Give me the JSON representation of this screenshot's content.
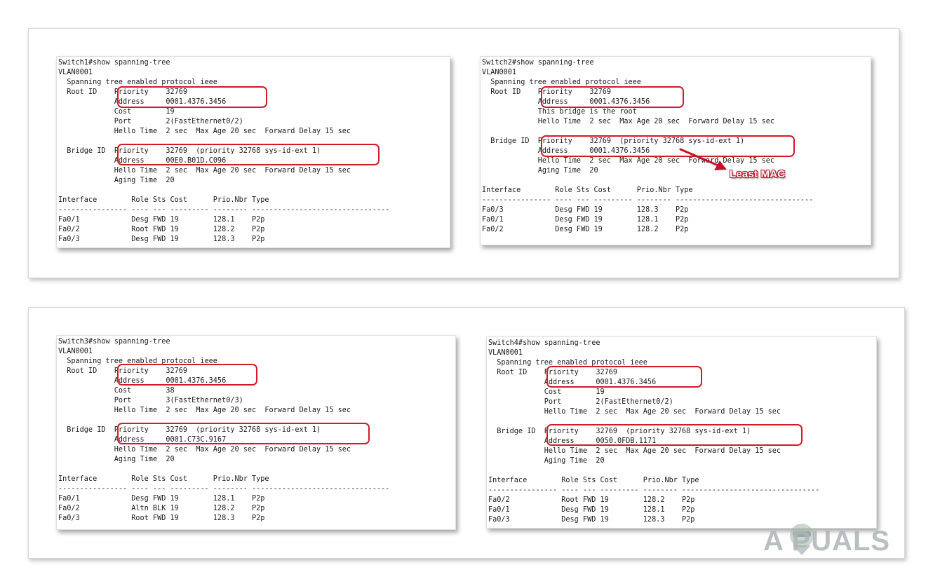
{
  "panels": [
    {
      "lines": [
        "Switch1#show spanning-tree",
        "VLAN0001",
        "  Spanning tree enabled protocol ieee",
        "  Root ID    Priority    32769",
        "             Address     0001.4376.3456",
        "             Cost        19",
        "             Port        2(FastEthernet0/2)",
        "             Hello Time  2 sec  Max Age 20 sec  Forward Delay 15 sec",
        "",
        "  Bridge ID  Priority    32769  (priority 32768 sys-id-ext 1)",
        "             Address     00E0.B01D.C096",
        "             Hello Time  2 sec  Max Age 20 sec  Forward Delay 15 sec",
        "             Aging Time  20",
        "",
        "Interface        Role Sts Cost      Prio.Nbr Type",
        "---------------- ---- --- --------- -------- --------------------------------",
        "Fa0/1            Desg FWD 19        128.1    P2p",
        "Fa0/2            Root FWD 19        128.2    P2p",
        "Fa0/3            Desg FWD 19        128.3    P2p"
      ]
    },
    {
      "lines": [
        "Switch2#show spanning-tree",
        "VLAN0001",
        "  Spanning tree enabled protocol ieee",
        "  Root ID    Priority    32769",
        "             Address     0001.4376.3456",
        "             This bridge is the root",
        "             Hello Time  2 sec  Max Age 20 sec  Forward Delay 15 sec",
        "",
        "  Bridge ID  Priority    32769  (priority 32768 sys-id-ext 1)",
        "             Address     0001.4376.3456",
        "             Hello Time  2 sec  Max Age 20 sec  Forward Delay 15 sec",
        "             Aging Time  20",
        "",
        "Interface        Role Sts Cost      Prio.Nbr Type",
        "---------------- ---- --- --------- -------- --------------------------------",
        "Fa0/3            Desg FWD 19        128.3    P2p",
        "Fa0/1            Desg FWD 19        128.1    P2p",
        "Fa0/2            Desg FWD 19        128.2    P2p"
      ]
    },
    {
      "lines": [
        "Switch3#show spanning-tree",
        "VLAN0001",
        "  Spanning tree enabled protocol ieee",
        "  Root ID    Priority    32769",
        "             Address     0001.4376.3456",
        "             Cost        38",
        "             Port        3(FastEthernet0/3)",
        "             Hello Time  2 sec  Max Age 20 sec  Forward Delay 15 sec",
        "",
        "  Bridge ID  Priority    32769  (priority 32768 sys-id-ext 1)",
        "             Address     0001.C73C.9167",
        "             Hello Time  2 sec  Max Age 20 sec  Forward Delay 15 sec",
        "             Aging Time  20",
        "",
        "Interface        Role Sts Cost      Prio.Nbr Type",
        "---------------- ---- --- --------- -------- --------------------------------",
        "Fa0/1            Desg FWD 19        128.1    P2p",
        "Fa0/2            Altn BLK 19        128.2    P2p",
        "Fa0/3            Root FWD 19        128.3    P2p"
      ]
    },
    {
      "lines": [
        "Switch4#show spanning-tree",
        "VLAN0001",
        "  Spanning tree enabled protocol ieee",
        "  Root ID    Priority    32769",
        "             Address     0001.4376.3456",
        "             Cost        19",
        "             Port        2(FastEthernet0/2)",
        "             Hello Time  2 sec  Max Age 20 sec  Forward Delay 15 sec",
        "",
        "  Bridge ID  Priority    32769  (priority 32768 sys-id-ext 1)",
        "             Address     0050.0FDB.1171",
        "             Hello Time  2 sec  Max Age 20 sec  Forward Delay 15 sec",
        "             Aging Time  20",
        "",
        "Interface        Role Sts Cost      Prio.Nbr Type",
        "---------------- ---- --- --------- -------- --------------------------------",
        "Fa0/2            Root FWD 19        128.2    P2p",
        "Fa0/1            Desg FWD 19        128.1    P2p",
        "Fa0/3            Desg FWD 19        128.3    P2p"
      ]
    }
  ],
  "annotation": {
    "label": "Least MAC"
  },
  "watermark": {
    "text": "A  PUALS"
  },
  "colors": {
    "highlight": "#d21a2a",
    "callout": "#c8102e"
  }
}
